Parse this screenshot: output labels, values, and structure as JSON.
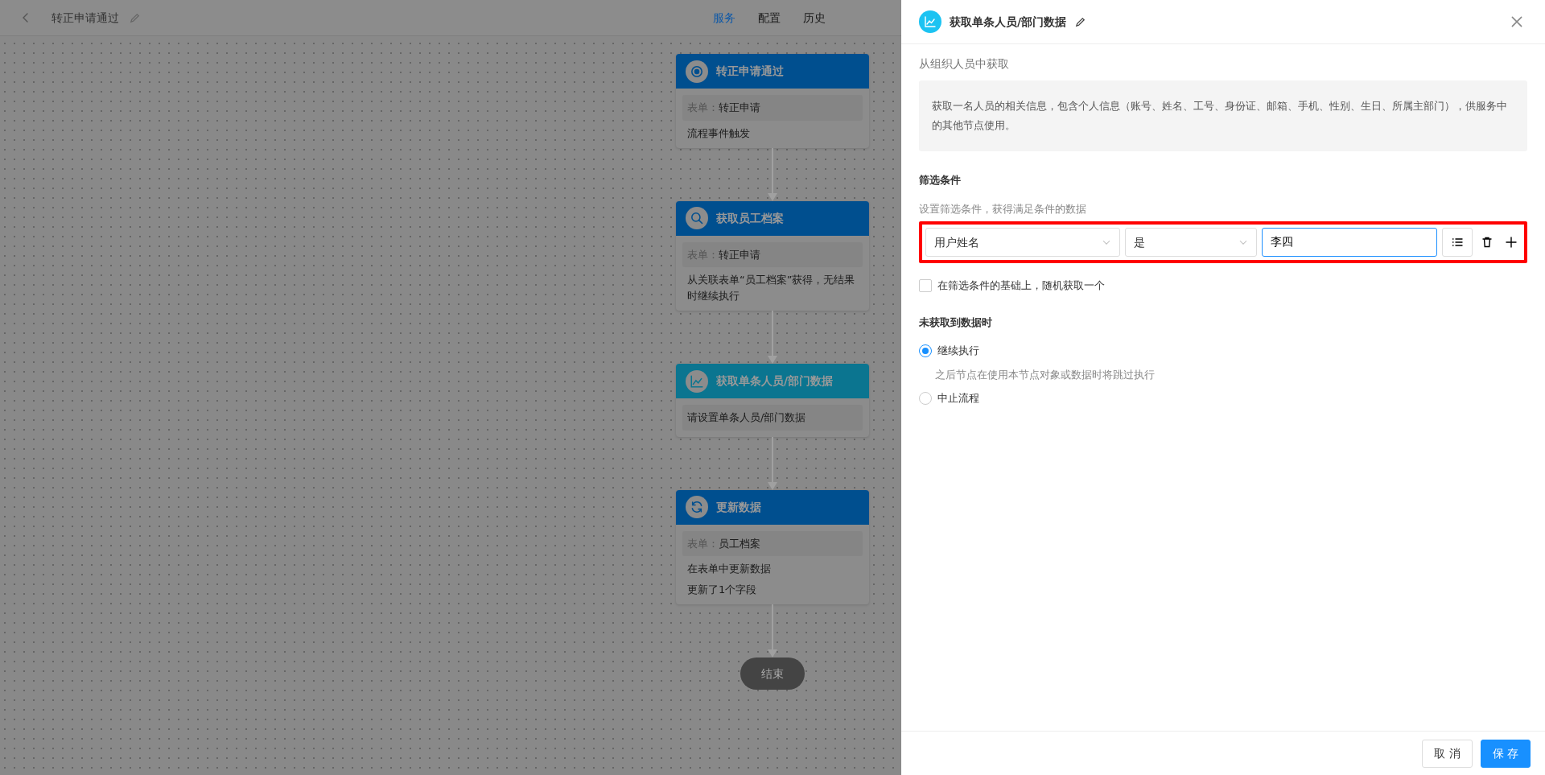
{
  "top_bar": {
    "title": "转正申请通过",
    "tabs": [
      {
        "label": "服务",
        "selected": true
      },
      {
        "label": "配置",
        "selected": false
      },
      {
        "label": "历史",
        "selected": false
      }
    ]
  },
  "flow": {
    "nodes": [
      {
        "kind": "trigger",
        "title": "转正申请通过",
        "color": "#004f8f",
        "field": {
          "label": "表单：",
          "value": "转正申请"
        },
        "lines": [
          "流程事件触发"
        ]
      },
      {
        "kind": "search",
        "title": "获取员工档案",
        "color": "#004f8f",
        "field": {
          "label": "表单：",
          "value": "转正申请"
        },
        "lines": [
          "从关联表单“员工档案”获得，无结果时继续执行"
        ]
      },
      {
        "kind": "chart",
        "title": "获取单条人员/部门数据",
        "color": "#0b7590",
        "field": {
          "value": "请设置单条人员/部门数据"
        }
      },
      {
        "kind": "refresh",
        "title": "更新数据",
        "color": "#004f8f",
        "field": {
          "label": "表单：",
          "value": "员工档案"
        },
        "lines": [
          "在表单中更新数据",
          "更新了1个字段"
        ]
      }
    ],
    "end_label": "结束"
  },
  "panel": {
    "title": "获取单条人员/部门数据",
    "source": "从组织人员中获取",
    "description": "获取一名人员的相关信息，包含个人信息（账号、姓名、工号、身份证、邮箱、手机、性别、生日、所属主部门），供服务中的其他节点使用。",
    "filter": {
      "heading": "筛选条件",
      "hint": "设置筛选条件，获得满足条件的数据",
      "highlight": true,
      "conditions": [
        {
          "field": "用户姓名",
          "operator": "是",
          "value": "李四"
        }
      ]
    },
    "random_pick": {
      "label": "在筛选条件的基础上，随机获取一个",
      "checked": false
    },
    "fallback": {
      "heading": "未获取到数据时",
      "options": [
        {
          "label": "继续执行",
          "selected": true,
          "note": "之后节点在使用本节点对象或数据时将跳过执行"
        },
        {
          "label": "中止流程",
          "selected": false
        }
      ]
    },
    "buttons": [
      {
        "label": "取 消",
        "kind": "secondary"
      },
      {
        "label": "保 存",
        "kind": "primary"
      }
    ]
  }
}
